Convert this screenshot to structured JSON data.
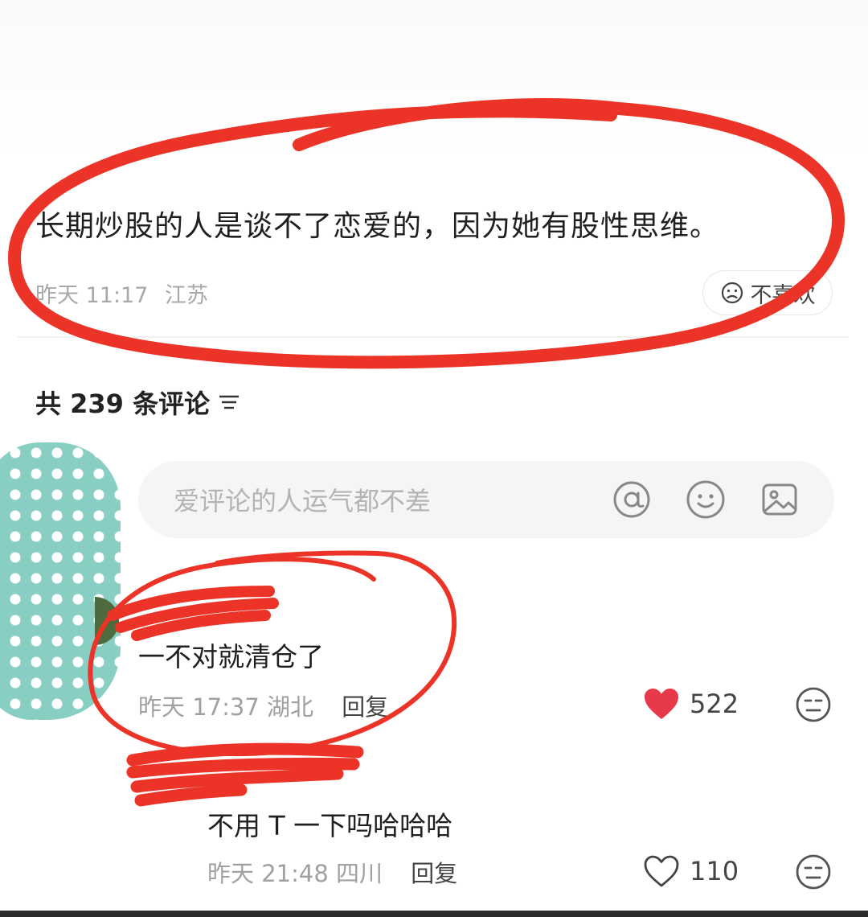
{
  "post": {
    "text": "长期炒股的人是谈不了恋爱的，因为她有股性思维。",
    "time": "昨天 11:17",
    "location": "江苏",
    "dislike_label": "不喜欢"
  },
  "comments_header": {
    "label": "共 239 条评论"
  },
  "comment_input": {
    "placeholder": "爱评论的人运气都不差",
    "icons": [
      "at-icon",
      "emoji-icon",
      "image-icon"
    ]
  },
  "comments": [
    {
      "text": "一不对就清仓了",
      "time": "昨天 17:37",
      "location": "湖北",
      "reply_label": "回复",
      "likes": "522",
      "liked": true
    },
    {
      "text": "不用 T 一下吗哈哈哈",
      "time": "昨天 21:48",
      "location": "四川",
      "reply_label": "回复",
      "likes": "110",
      "liked": false
    }
  ],
  "colors": {
    "annotation_red": "#ec3327",
    "like_red": "#e8394a",
    "dots_teal": "#7cc9bd"
  }
}
